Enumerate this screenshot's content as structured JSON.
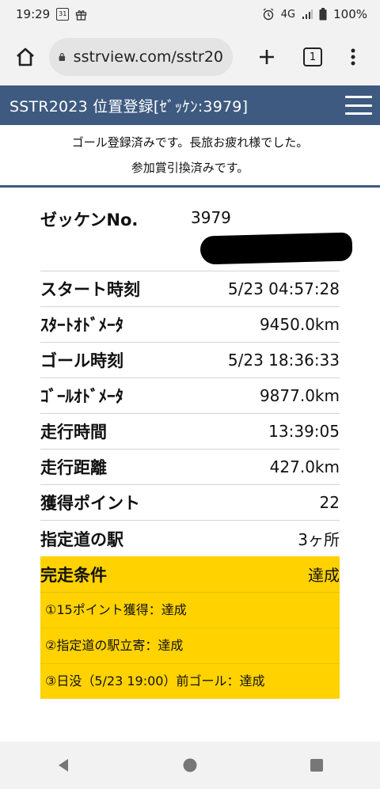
{
  "status_bar": {
    "time": "19:29",
    "calendar_day": "31",
    "network": "4G",
    "battery": "100%"
  },
  "browser": {
    "url": "sstrview.com/sstr20",
    "tab_count": "1"
  },
  "header": {
    "title": "SSTR2023 位置登録[ｾﾞｯｹﾝ:3979]"
  },
  "notice": {
    "line1": "ゴール登録済みです。長旅お疲れ様でした。",
    "line2": "参加賞引換済みです。"
  },
  "record": {
    "zekken_label": "ゼッケンNo.",
    "zekken_value": "3979",
    "rows": [
      {
        "label": "スタート時刻",
        "value": "5/23 04:57:28"
      },
      {
        "label": "ｽﾀｰﾄｵﾄﾞﾒｰﾀ",
        "value": "9450.0km"
      },
      {
        "label": "ゴール時刻",
        "value": "5/23 18:36:33"
      },
      {
        "label": "ｺﾞｰﾙｵﾄﾞﾒｰﾀ",
        "value": "9877.0km"
      },
      {
        "label": "走行時間",
        "value": "13:39:05"
      },
      {
        "label": "走行距離",
        "value": "427.0km"
      },
      {
        "label": "獲得ポイント",
        "value": "22"
      },
      {
        "label": "指定道の駅",
        "value": "3ヶ所"
      }
    ]
  },
  "condition": {
    "label": "完走条件",
    "value": "達成",
    "items": [
      "①15ポイント獲得：達成",
      "②指定道の駅立寄：達成",
      "③日没（5/23 19:00）前ゴール：達成"
    ]
  },
  "colors": {
    "header_bg": "#3e5a80",
    "condition_bg": "#ffd200"
  }
}
